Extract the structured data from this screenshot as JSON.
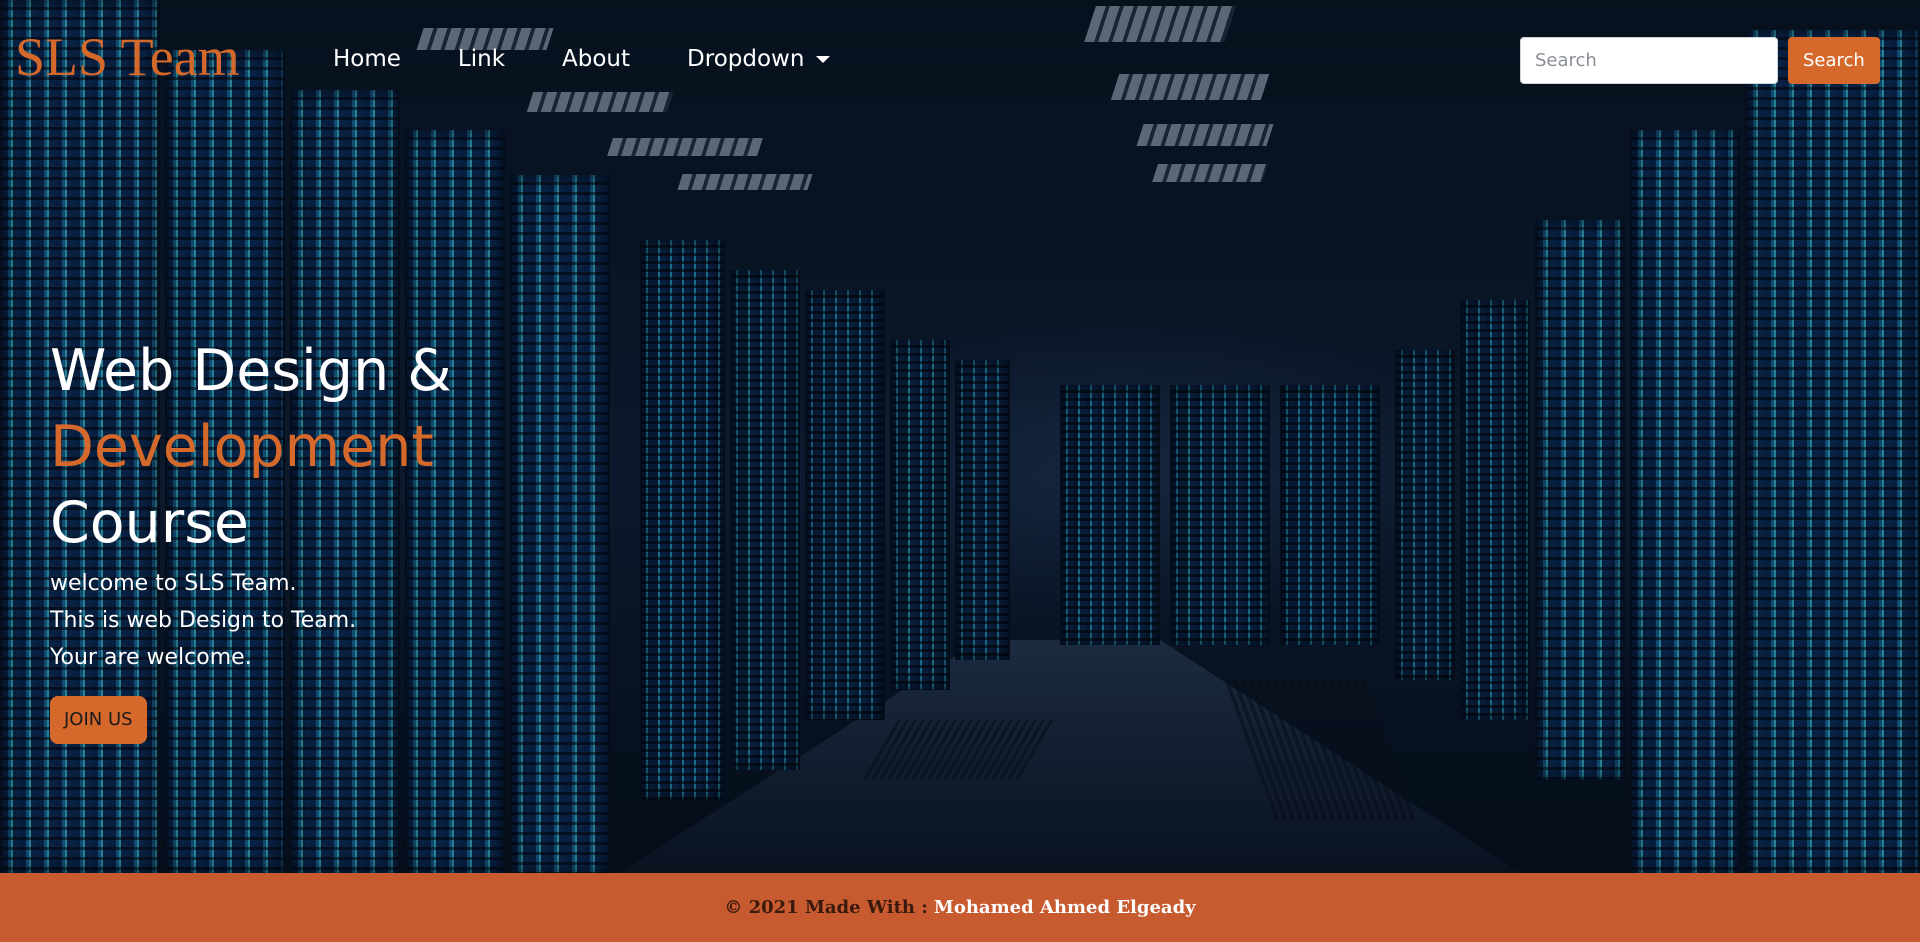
{
  "navbar": {
    "brand": "SLS Team",
    "links": [
      "Home",
      "Link",
      "About",
      "Dropdown"
    ],
    "search": {
      "placeholder": "Search",
      "value": "",
      "button_label": "Search"
    }
  },
  "hero": {
    "title_line1": "Web Design &",
    "title_line2": "Development",
    "title_line3": "Course",
    "text_line1": "welcome to SLS Team.",
    "text_line2": "This is web Design to Team.",
    "text_line3": "Your are welcome.",
    "join_label": "JOIN US"
  },
  "footer": {
    "text": "© 2021 Made With :",
    "author": "Mohamed Ahmed Elgeady"
  },
  "colors": {
    "accent": "#d5692c",
    "footer_bg": "#c85a30",
    "text": "#ffffff"
  },
  "icons": {
    "dropdown": "caret-down-icon"
  }
}
